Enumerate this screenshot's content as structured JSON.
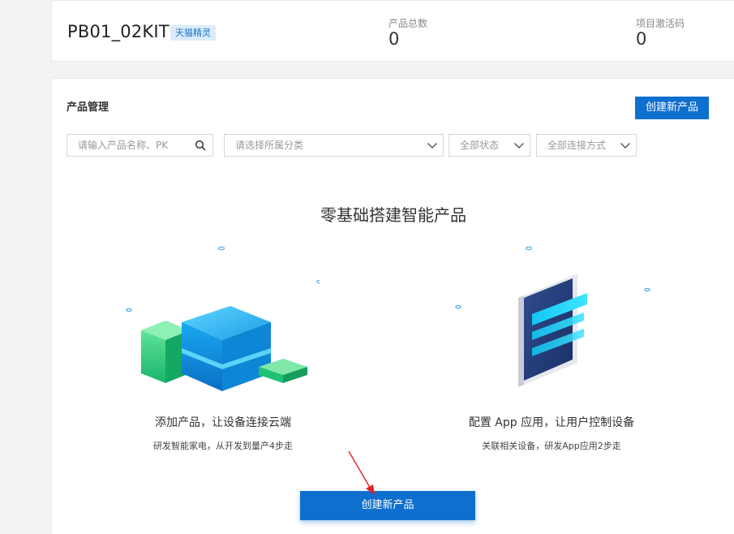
{
  "project": {
    "name": "PB01_02KIT",
    "badge": "天猫精灵",
    "stats": [
      {
        "label": "产品总数",
        "value": "0"
      },
      {
        "label": "项目激活码",
        "value": "0"
      }
    ]
  },
  "product_management": {
    "title": "产品管理",
    "create_button": "创建新产品",
    "filters": {
      "search_placeholder": "请输入产品名称、PK",
      "category_placeholder": "请选择所属分类",
      "status": "全部状态",
      "connection": "全部连接方式"
    }
  },
  "empty_state": {
    "title": "零基础搭建智能产品",
    "steps": [
      {
        "title": "添加产品，让设备连接云端",
        "subtitle": "研发智能家电，从开发到量产4步走"
      },
      {
        "title": "配置 App 应用，让用户控制设备",
        "subtitle": "关联相关设备，研发App应用2步走"
      }
    ],
    "create_button": "创建新产品"
  },
  "colors": {
    "primary": "#0f6fcf",
    "badge_bg": "#dcecfb",
    "annotation_arrow": "#e02020"
  }
}
